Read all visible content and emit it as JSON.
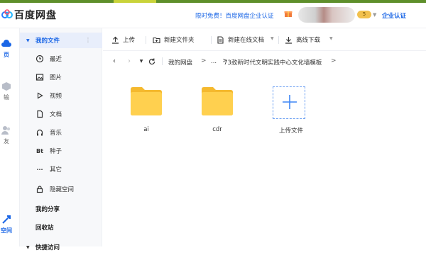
{
  "colors": {
    "accent": "#1a66e6",
    "folder": "#f7c948",
    "sidebar_bg": "#f7f8fa",
    "selected_bg": "#e8eefb"
  },
  "header": {
    "brand": "百度网盘",
    "promo": "限时免费！百度网盘企业认证",
    "vip_badge": "5",
    "enterprise": "企业认证"
  },
  "rail": {
    "items": [
      {
        "label": "页",
        "icon": "cloud-icon"
      },
      {
        "label": "输",
        "icon": "transfer-icon"
      },
      {
        "label": "友",
        "icon": "friends-icon"
      },
      {
        "label": "空间",
        "icon": "space-icon"
      }
    ]
  },
  "sidebar": {
    "my_files": "我的文件",
    "items": [
      {
        "label": "最近",
        "icon": "clock-icon"
      },
      {
        "label": "图片",
        "icon": "image-icon"
      },
      {
        "label": "视频",
        "icon": "video-icon"
      },
      {
        "label": "文档",
        "icon": "document-icon"
      },
      {
        "label": "音乐",
        "icon": "music-icon"
      },
      {
        "label": "种子",
        "icon": "bt-icon",
        "glyph": "Bt"
      },
      {
        "label": "其它",
        "icon": "more-icon",
        "glyph": "···"
      },
      {
        "label": "隐藏空间",
        "icon": "lock-icon"
      }
    ],
    "my_share": "我的分享",
    "recycle": "回收站",
    "quick_access": "快捷访问"
  },
  "toolbar": {
    "upload": "上传",
    "new_folder": "新建文件夹",
    "new_online_doc": "新建在线文档",
    "offline_download": "离线下载"
  },
  "breadcrumb": {
    "root": "我的网盘",
    "ellipsis": "...",
    "current": "73款新时代文明实践中心文化墙模板",
    "sep": ">"
  },
  "files": [
    {
      "name": "ai",
      "type": "folder"
    },
    {
      "name": "cdr",
      "type": "folder"
    }
  ],
  "upload_tile": {
    "label": "上传文件"
  }
}
